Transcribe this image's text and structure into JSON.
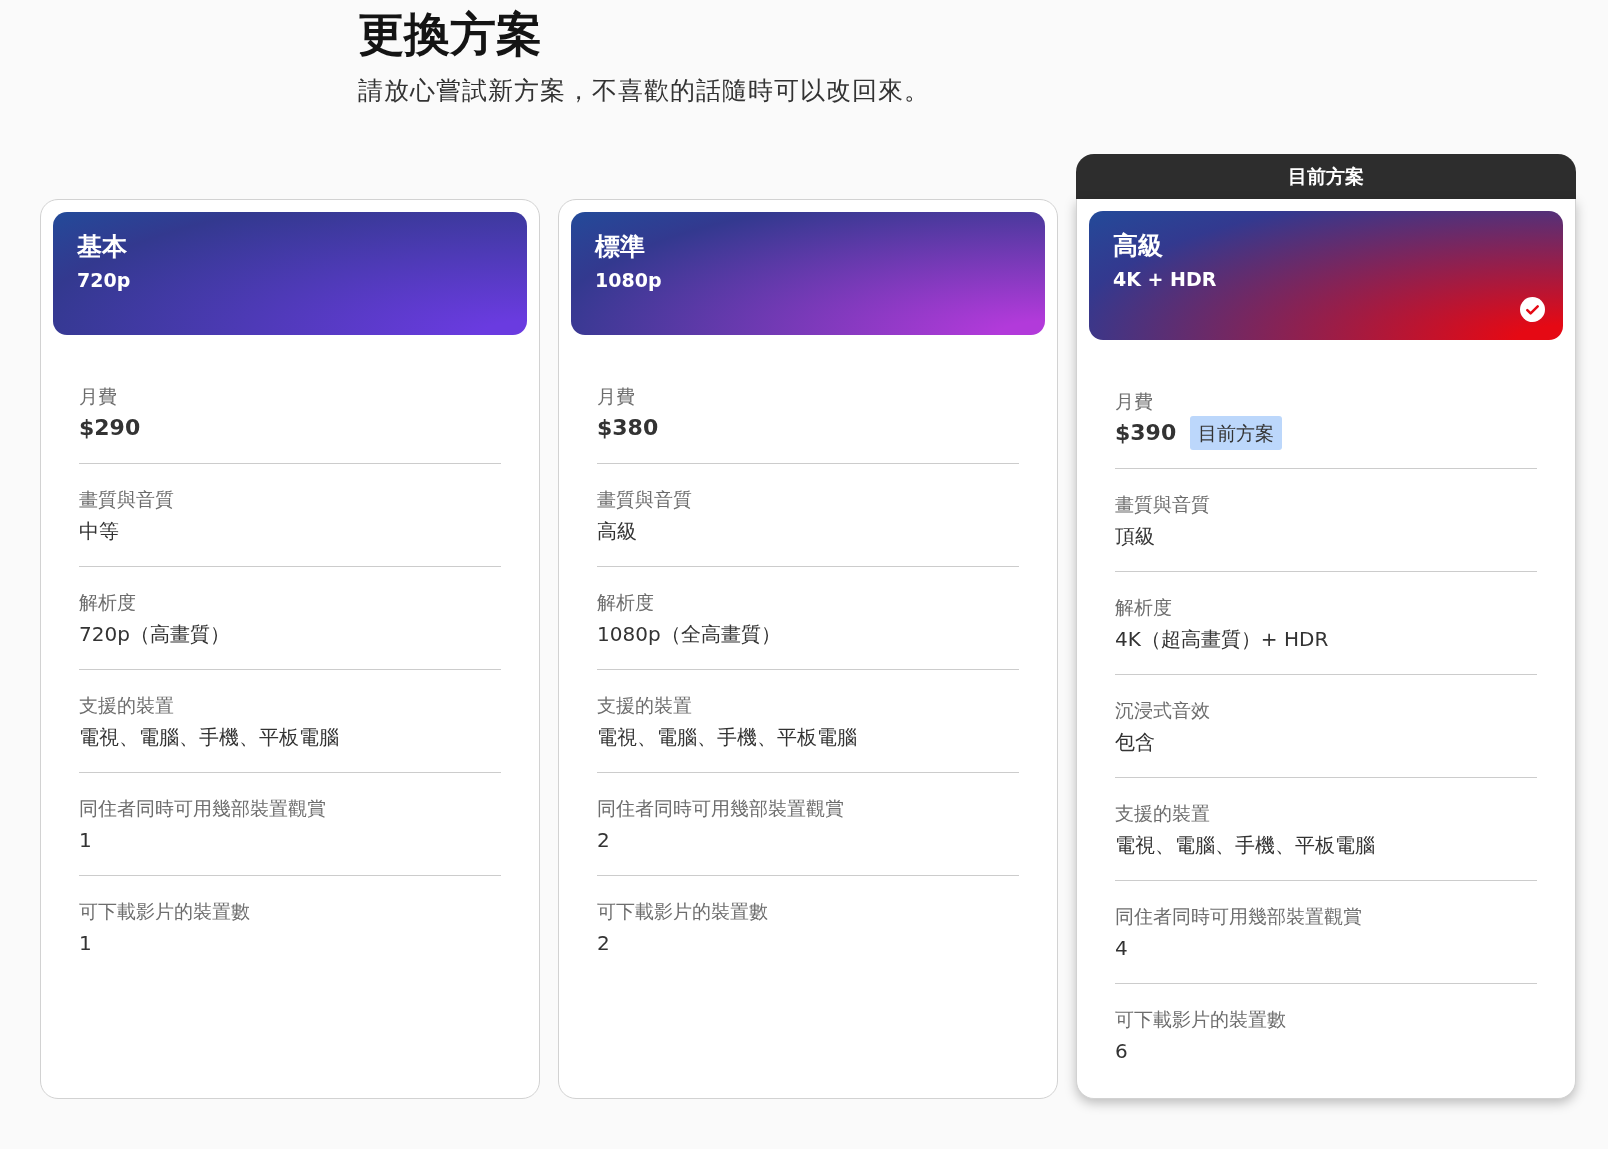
{
  "page": {
    "title": "更換方案",
    "subtitle": "請放心嘗試新方案，不喜歡的話隨時可以改回來。"
  },
  "plans": [
    {
      "name": "基本",
      "resolution": "720p",
      "selected": false,
      "color": "#6a3be0",
      "rows": [
        {
          "label": "月費",
          "value": "$290"
        },
        {
          "label": "畫質與音質",
          "value": "中等"
        },
        {
          "label": "解析度",
          "value": "720p（高畫質）"
        },
        {
          "label": "支援的裝置",
          "value": "電視、電腦、手機、平板電腦"
        },
        {
          "label": "同住者同時可用幾部裝置觀賞",
          "value": "1"
        },
        {
          "label": "可下載影片的裝置數",
          "value": "1"
        }
      ]
    },
    {
      "name": "標準",
      "resolution": "1080p",
      "selected": false,
      "color": "#b23ada",
      "rows": [
        {
          "label": "月費",
          "value": "$380"
        },
        {
          "label": "畫質與音質",
          "value": "高級"
        },
        {
          "label": "解析度",
          "value": "1080p（全高畫質）"
        },
        {
          "label": "支援的裝置",
          "value": "電視、電腦、手機、平板電腦"
        },
        {
          "label": "同住者同時可用幾部裝置觀賞",
          "value": "2"
        },
        {
          "label": "可下載影片的裝置數",
          "value": "2"
        }
      ]
    },
    {
      "name": "高級",
      "resolution": "4K + HDR",
      "selected": true,
      "color": "#e50914",
      "banner": "目前方案",
      "rows": [
        {
          "label": "月費",
          "value": "$390",
          "badge": "目前方案"
        },
        {
          "label": "畫質與音質",
          "value": "頂級"
        },
        {
          "label": "解析度",
          "value": "4K（超高畫質）+ HDR"
        },
        {
          "label": "沉浸式音效",
          "value": "包含"
        },
        {
          "label": "支援的裝置",
          "value": "電視、電腦、手機、平板電腦"
        },
        {
          "label": "同住者同時可用幾部裝置觀賞",
          "value": "4"
        },
        {
          "label": "可下載影片的裝置數",
          "value": "6"
        }
      ]
    }
  ]
}
